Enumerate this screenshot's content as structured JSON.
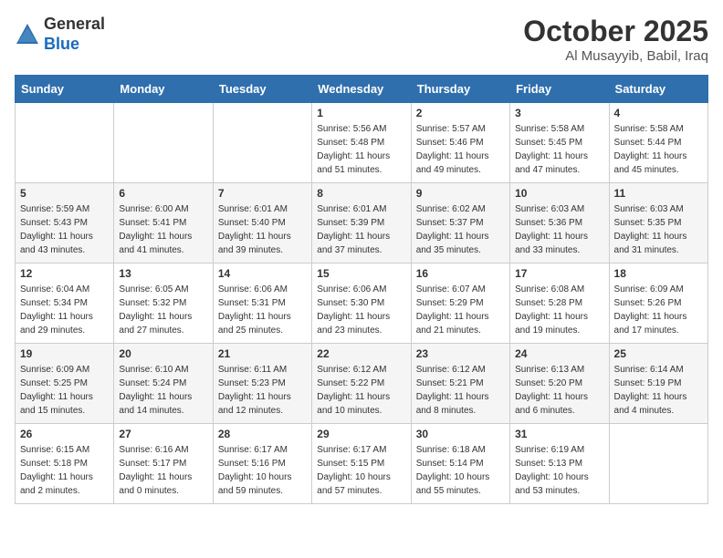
{
  "header": {
    "logo_general": "General",
    "logo_blue": "Blue",
    "month_title": "October 2025",
    "location": "Al Musayyib, Babil, Iraq"
  },
  "weekdays": [
    "Sunday",
    "Monday",
    "Tuesday",
    "Wednesday",
    "Thursday",
    "Friday",
    "Saturday"
  ],
  "weeks": [
    [
      {
        "day": "",
        "sunrise": "",
        "sunset": "",
        "daylight": ""
      },
      {
        "day": "",
        "sunrise": "",
        "sunset": "",
        "daylight": ""
      },
      {
        "day": "",
        "sunrise": "",
        "sunset": "",
        "daylight": ""
      },
      {
        "day": "1",
        "sunrise": "Sunrise: 5:56 AM",
        "sunset": "Sunset: 5:48 PM",
        "daylight": "Daylight: 11 hours and 51 minutes."
      },
      {
        "day": "2",
        "sunrise": "Sunrise: 5:57 AM",
        "sunset": "Sunset: 5:46 PM",
        "daylight": "Daylight: 11 hours and 49 minutes."
      },
      {
        "day": "3",
        "sunrise": "Sunrise: 5:58 AM",
        "sunset": "Sunset: 5:45 PM",
        "daylight": "Daylight: 11 hours and 47 minutes."
      },
      {
        "day": "4",
        "sunrise": "Sunrise: 5:58 AM",
        "sunset": "Sunset: 5:44 PM",
        "daylight": "Daylight: 11 hours and 45 minutes."
      }
    ],
    [
      {
        "day": "5",
        "sunrise": "Sunrise: 5:59 AM",
        "sunset": "Sunset: 5:43 PM",
        "daylight": "Daylight: 11 hours and 43 minutes."
      },
      {
        "day": "6",
        "sunrise": "Sunrise: 6:00 AM",
        "sunset": "Sunset: 5:41 PM",
        "daylight": "Daylight: 11 hours and 41 minutes."
      },
      {
        "day": "7",
        "sunrise": "Sunrise: 6:01 AM",
        "sunset": "Sunset: 5:40 PM",
        "daylight": "Daylight: 11 hours and 39 minutes."
      },
      {
        "day": "8",
        "sunrise": "Sunrise: 6:01 AM",
        "sunset": "Sunset: 5:39 PM",
        "daylight": "Daylight: 11 hours and 37 minutes."
      },
      {
        "day": "9",
        "sunrise": "Sunrise: 6:02 AM",
        "sunset": "Sunset: 5:37 PM",
        "daylight": "Daylight: 11 hours and 35 minutes."
      },
      {
        "day": "10",
        "sunrise": "Sunrise: 6:03 AM",
        "sunset": "Sunset: 5:36 PM",
        "daylight": "Daylight: 11 hours and 33 minutes."
      },
      {
        "day": "11",
        "sunrise": "Sunrise: 6:03 AM",
        "sunset": "Sunset: 5:35 PM",
        "daylight": "Daylight: 11 hours and 31 minutes."
      }
    ],
    [
      {
        "day": "12",
        "sunrise": "Sunrise: 6:04 AM",
        "sunset": "Sunset: 5:34 PM",
        "daylight": "Daylight: 11 hours and 29 minutes."
      },
      {
        "day": "13",
        "sunrise": "Sunrise: 6:05 AM",
        "sunset": "Sunset: 5:32 PM",
        "daylight": "Daylight: 11 hours and 27 minutes."
      },
      {
        "day": "14",
        "sunrise": "Sunrise: 6:06 AM",
        "sunset": "Sunset: 5:31 PM",
        "daylight": "Daylight: 11 hours and 25 minutes."
      },
      {
        "day": "15",
        "sunrise": "Sunrise: 6:06 AM",
        "sunset": "Sunset: 5:30 PM",
        "daylight": "Daylight: 11 hours and 23 minutes."
      },
      {
        "day": "16",
        "sunrise": "Sunrise: 6:07 AM",
        "sunset": "Sunset: 5:29 PM",
        "daylight": "Daylight: 11 hours and 21 minutes."
      },
      {
        "day": "17",
        "sunrise": "Sunrise: 6:08 AM",
        "sunset": "Sunset: 5:28 PM",
        "daylight": "Daylight: 11 hours and 19 minutes."
      },
      {
        "day": "18",
        "sunrise": "Sunrise: 6:09 AM",
        "sunset": "Sunset: 5:26 PM",
        "daylight": "Daylight: 11 hours and 17 minutes."
      }
    ],
    [
      {
        "day": "19",
        "sunrise": "Sunrise: 6:09 AM",
        "sunset": "Sunset: 5:25 PM",
        "daylight": "Daylight: 11 hours and 15 minutes."
      },
      {
        "day": "20",
        "sunrise": "Sunrise: 6:10 AM",
        "sunset": "Sunset: 5:24 PM",
        "daylight": "Daylight: 11 hours and 14 minutes."
      },
      {
        "day": "21",
        "sunrise": "Sunrise: 6:11 AM",
        "sunset": "Sunset: 5:23 PM",
        "daylight": "Daylight: 11 hours and 12 minutes."
      },
      {
        "day": "22",
        "sunrise": "Sunrise: 6:12 AM",
        "sunset": "Sunset: 5:22 PM",
        "daylight": "Daylight: 11 hours and 10 minutes."
      },
      {
        "day": "23",
        "sunrise": "Sunrise: 6:12 AM",
        "sunset": "Sunset: 5:21 PM",
        "daylight": "Daylight: 11 hours and 8 minutes."
      },
      {
        "day": "24",
        "sunrise": "Sunrise: 6:13 AM",
        "sunset": "Sunset: 5:20 PM",
        "daylight": "Daylight: 11 hours and 6 minutes."
      },
      {
        "day": "25",
        "sunrise": "Sunrise: 6:14 AM",
        "sunset": "Sunset: 5:19 PM",
        "daylight": "Daylight: 11 hours and 4 minutes."
      }
    ],
    [
      {
        "day": "26",
        "sunrise": "Sunrise: 6:15 AM",
        "sunset": "Sunset: 5:18 PM",
        "daylight": "Daylight: 11 hours and 2 minutes."
      },
      {
        "day": "27",
        "sunrise": "Sunrise: 6:16 AM",
        "sunset": "Sunset: 5:17 PM",
        "daylight": "Daylight: 11 hours and 0 minutes."
      },
      {
        "day": "28",
        "sunrise": "Sunrise: 6:17 AM",
        "sunset": "Sunset: 5:16 PM",
        "daylight": "Daylight: 10 hours and 59 minutes."
      },
      {
        "day": "29",
        "sunrise": "Sunrise: 6:17 AM",
        "sunset": "Sunset: 5:15 PM",
        "daylight": "Daylight: 10 hours and 57 minutes."
      },
      {
        "day": "30",
        "sunrise": "Sunrise: 6:18 AM",
        "sunset": "Sunset: 5:14 PM",
        "daylight": "Daylight: 10 hours and 55 minutes."
      },
      {
        "day": "31",
        "sunrise": "Sunrise: 6:19 AM",
        "sunset": "Sunset: 5:13 PM",
        "daylight": "Daylight: 10 hours and 53 minutes."
      },
      {
        "day": "",
        "sunrise": "",
        "sunset": "",
        "daylight": ""
      }
    ]
  ]
}
